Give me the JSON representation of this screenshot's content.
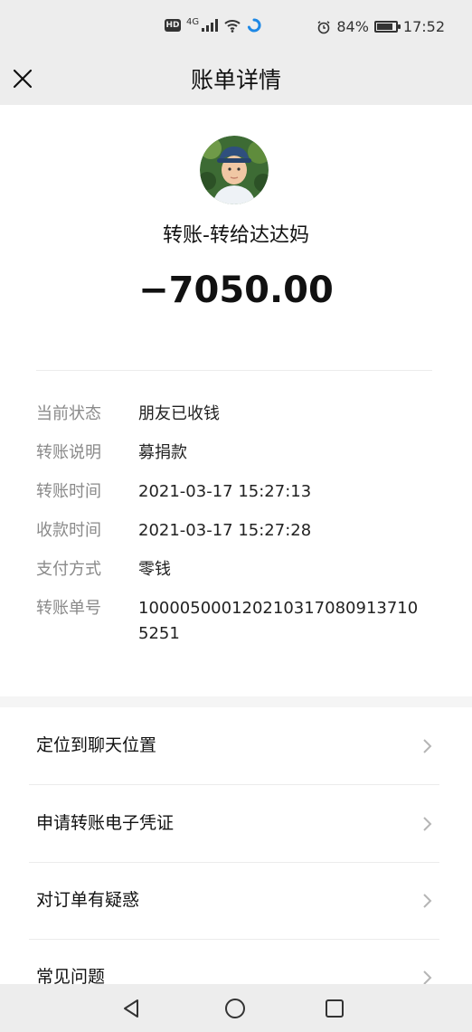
{
  "status_bar": {
    "hd": "HD",
    "network": "4G",
    "battery_percent": "84%",
    "time": "17:52",
    "battery_level": 0.84,
    "icons": [
      "hd-icon",
      "signal-icon",
      "wifi-icon",
      "app-notification-icon",
      "alarm-icon",
      "battery-icon"
    ]
  },
  "header": {
    "title": "账单详情",
    "close_icon": "close-icon"
  },
  "summary": {
    "payee": "转账-转给达达妈",
    "amount": "−7050.00"
  },
  "details": [
    {
      "label": "当前状态",
      "value": "朋友已收钱"
    },
    {
      "label": "转账说明",
      "value": "募捐款"
    },
    {
      "label": "转账时间",
      "value": "2021-03-17 15:27:13"
    },
    {
      "label": "收款时间",
      "value": "2021-03-17 15:27:28"
    },
    {
      "label": "支付方式",
      "value": "零钱"
    },
    {
      "label": "转账单号",
      "value": "1000050001202103170809137105251"
    }
  ],
  "menu": [
    {
      "label": "定位到聊天位置"
    },
    {
      "label": "申请转账电子凭证"
    },
    {
      "label": "对订单有疑惑"
    },
    {
      "label": "常见问题"
    }
  ],
  "system_nav": [
    "back-icon",
    "home-icon",
    "recents-icon"
  ],
  "colors": {
    "bar_background": "#ededed",
    "label_gray": "#8a8a8a",
    "text_dark": "#111111",
    "notification_blue": "#1e88e5"
  }
}
